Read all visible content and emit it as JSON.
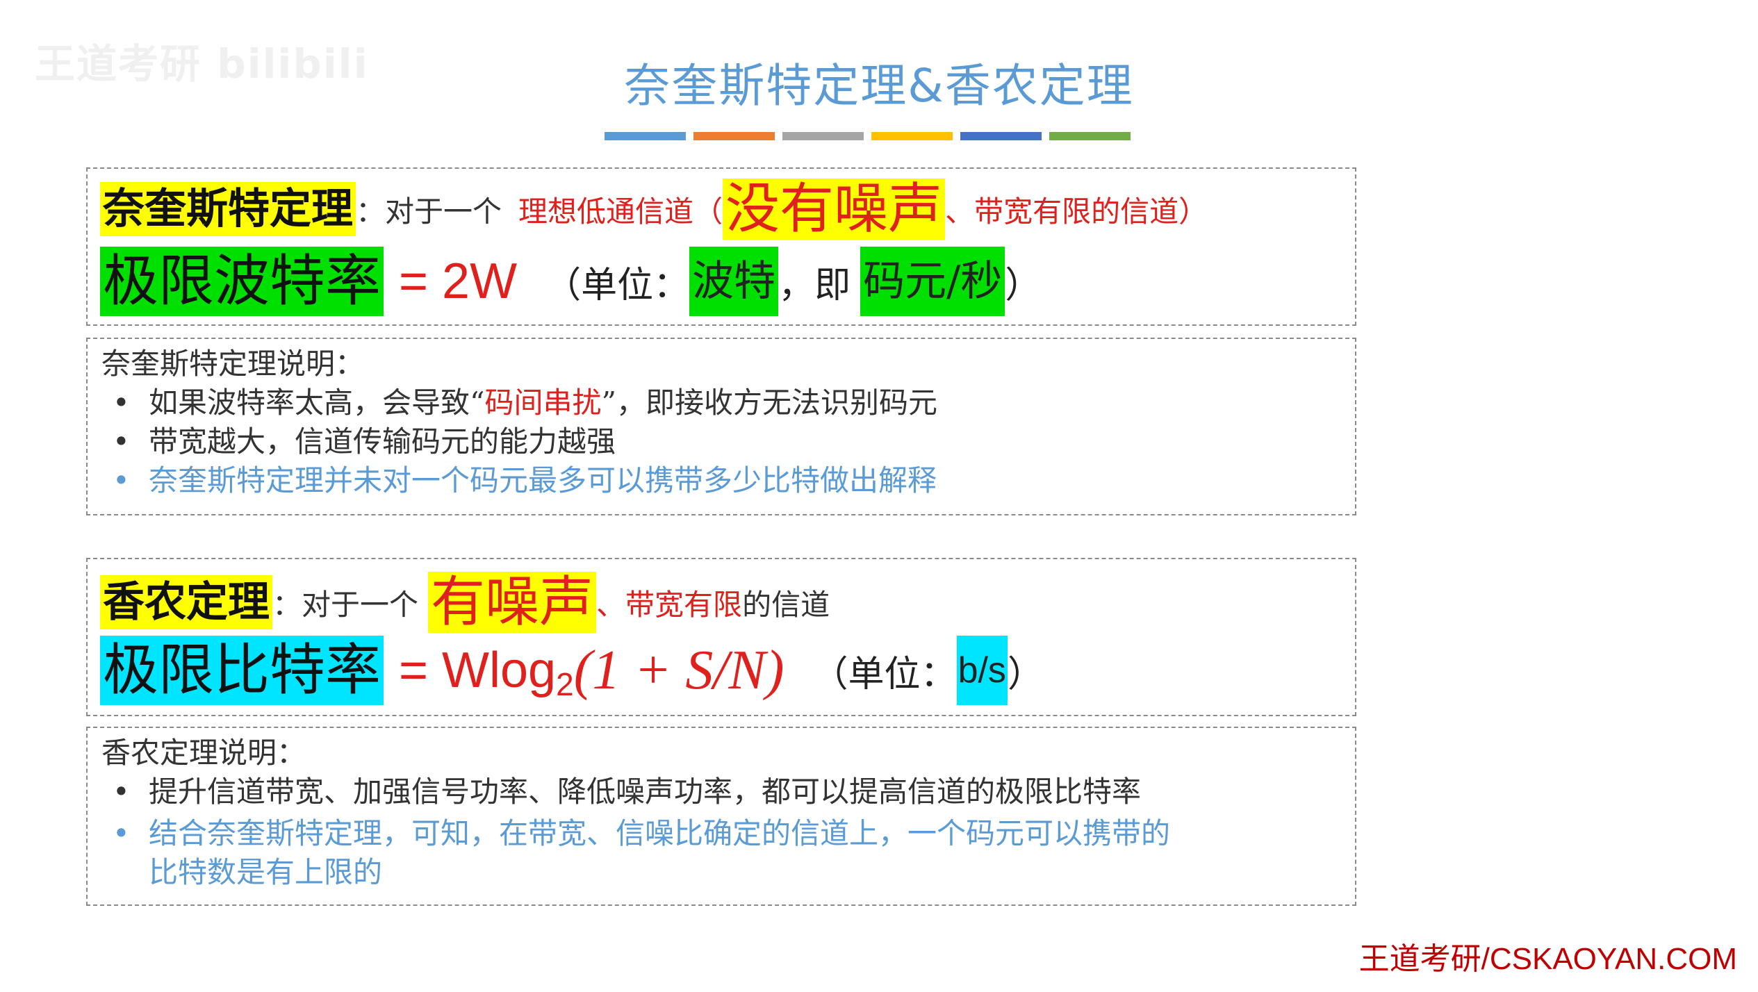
{
  "watermark": {
    "text": "王道考研 bilibili"
  },
  "title": "奈奎斯特定理&香农定理",
  "color_bars": [
    "#5b9bd5",
    "#ed7d31",
    "#a5a5a5",
    "#ffc000",
    "#4472c4",
    "#70ad47"
  ],
  "nyquist": {
    "heading": "奈奎斯特定理",
    "colon": "：",
    "intro": "对于一个",
    "channel_desc_a": "理想低通信道（",
    "no_noise": "没有噪声",
    "channel_desc_b": "、带宽有限的信道）",
    "formula_label": "极限波特率",
    "formula": "= 2W",
    "unit_open": "（单位：",
    "unit_baud": "波特",
    "unit_mid": "，即",
    "unit_symbols": "码元/秒",
    "unit_close": "）"
  },
  "nyquist_notes": {
    "title": "奈奎斯特定理说明：",
    "bullets": [
      {
        "a": "如果波特率太高，会导致“",
        "b": "码间串扰",
        "c": "”，即接收方无法识别码元"
      },
      {
        "a": "带宽越大，信道传输码元的能力越强"
      },
      {
        "a": "奈奎斯特定理并未对一个码元最多可以携带多少比特做出解释"
      }
    ]
  },
  "shannon": {
    "heading": "香农定理",
    "colon": "：",
    "intro": "对于一个",
    "noise": "有噪声",
    "channel_desc": "、带宽有限",
    "channel_end": "的信道",
    "formula_label": "极限比特率",
    "formula_prefix": "= Wlog",
    "formula_sub": "2",
    "formula_body": "(1 + S/N)",
    "unit_open": "（单位：",
    "unit_bps": "b/s",
    "unit_close": "）"
  },
  "shannon_notes": {
    "title": "香农定理说明：",
    "bullets": [
      {
        "a": "提升信道带宽、加强信号功率、降低噪声功率，都可以提高信道的极限比特率"
      },
      {
        "a": "结合奈奎斯特定理，可知，在带宽、信噪比确定的信道上，一个码元可以携带的",
        "b": "比特数是有上限的"
      }
    ]
  },
  "footer": "王道考研/CSKAOYAN.COM",
  "bullet_char": "•"
}
